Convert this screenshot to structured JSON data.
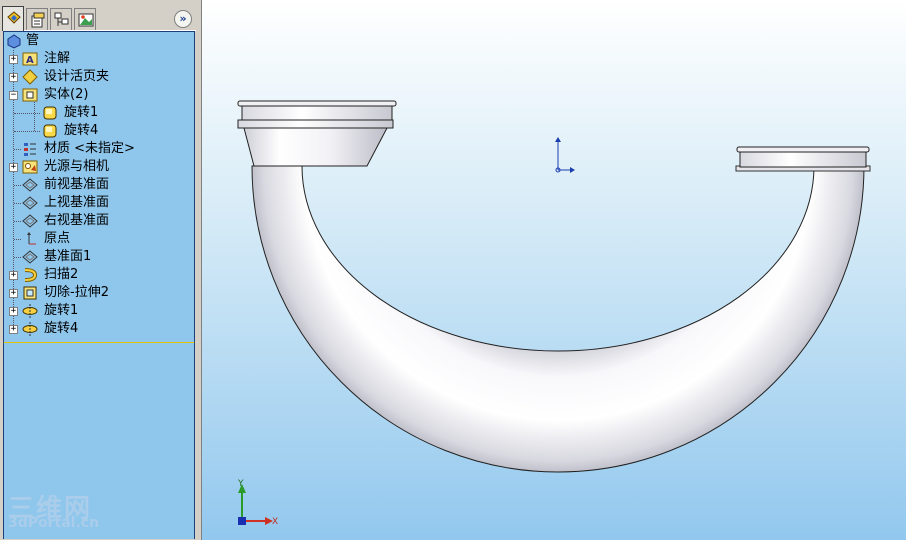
{
  "feature_tree": {
    "root_label": "管",
    "items": [
      {
        "label": "注解",
        "icon": "annotations-icon",
        "expander": "+"
      },
      {
        "label": "设计活页夹",
        "icon": "design-binder-icon",
        "expander": "+"
      },
      {
        "label": "实体(2)",
        "icon": "solid-bodies-icon",
        "expander": "−"
      },
      {
        "label": "旋转1",
        "icon": "body-icon",
        "expander": ""
      },
      {
        "label": "旋转4",
        "icon": "body-icon",
        "expander": ""
      },
      {
        "label": "材质 <未指定>",
        "icon": "material-icon",
        "expander": ""
      },
      {
        "label": "光源与相机",
        "icon": "lights-camera-icon",
        "expander": "+"
      },
      {
        "label": "前视基准面",
        "icon": "plane-icon",
        "expander": ""
      },
      {
        "label": "上视基准面",
        "icon": "plane-icon",
        "expander": ""
      },
      {
        "label": "右视基准面",
        "icon": "plane-icon",
        "expander": ""
      },
      {
        "label": "原点",
        "icon": "origin-icon",
        "expander": ""
      },
      {
        "label": "基准面1",
        "icon": "plane-icon",
        "expander": ""
      },
      {
        "label": "扫描2",
        "icon": "sweep-icon",
        "expander": "+"
      },
      {
        "label": "切除-拉伸2",
        "icon": "cut-extrude-icon",
        "expander": "+"
      },
      {
        "label": "旋转1",
        "icon": "revolve-icon",
        "expander": "+"
      },
      {
        "label": "旋转4",
        "icon": "revolve-icon",
        "expander": "+"
      }
    ]
  },
  "panel": {
    "tabs": [
      "FeatureManager",
      "PropertyManager",
      "ConfigurationManager",
      "DisplayManager"
    ],
    "collapse_glyph": "»"
  },
  "viewport": {
    "triad_x": "X",
    "triad_y": "Y",
    "watermark_line1": "三维网",
    "watermark_line2": "3dPortal.cn"
  },
  "colors": {
    "tree_bg": "#8ec6ec",
    "viewport_top": "#ffffff",
    "viewport_bottom": "#92c8ee",
    "rollback_bar": "#e2c400"
  }
}
